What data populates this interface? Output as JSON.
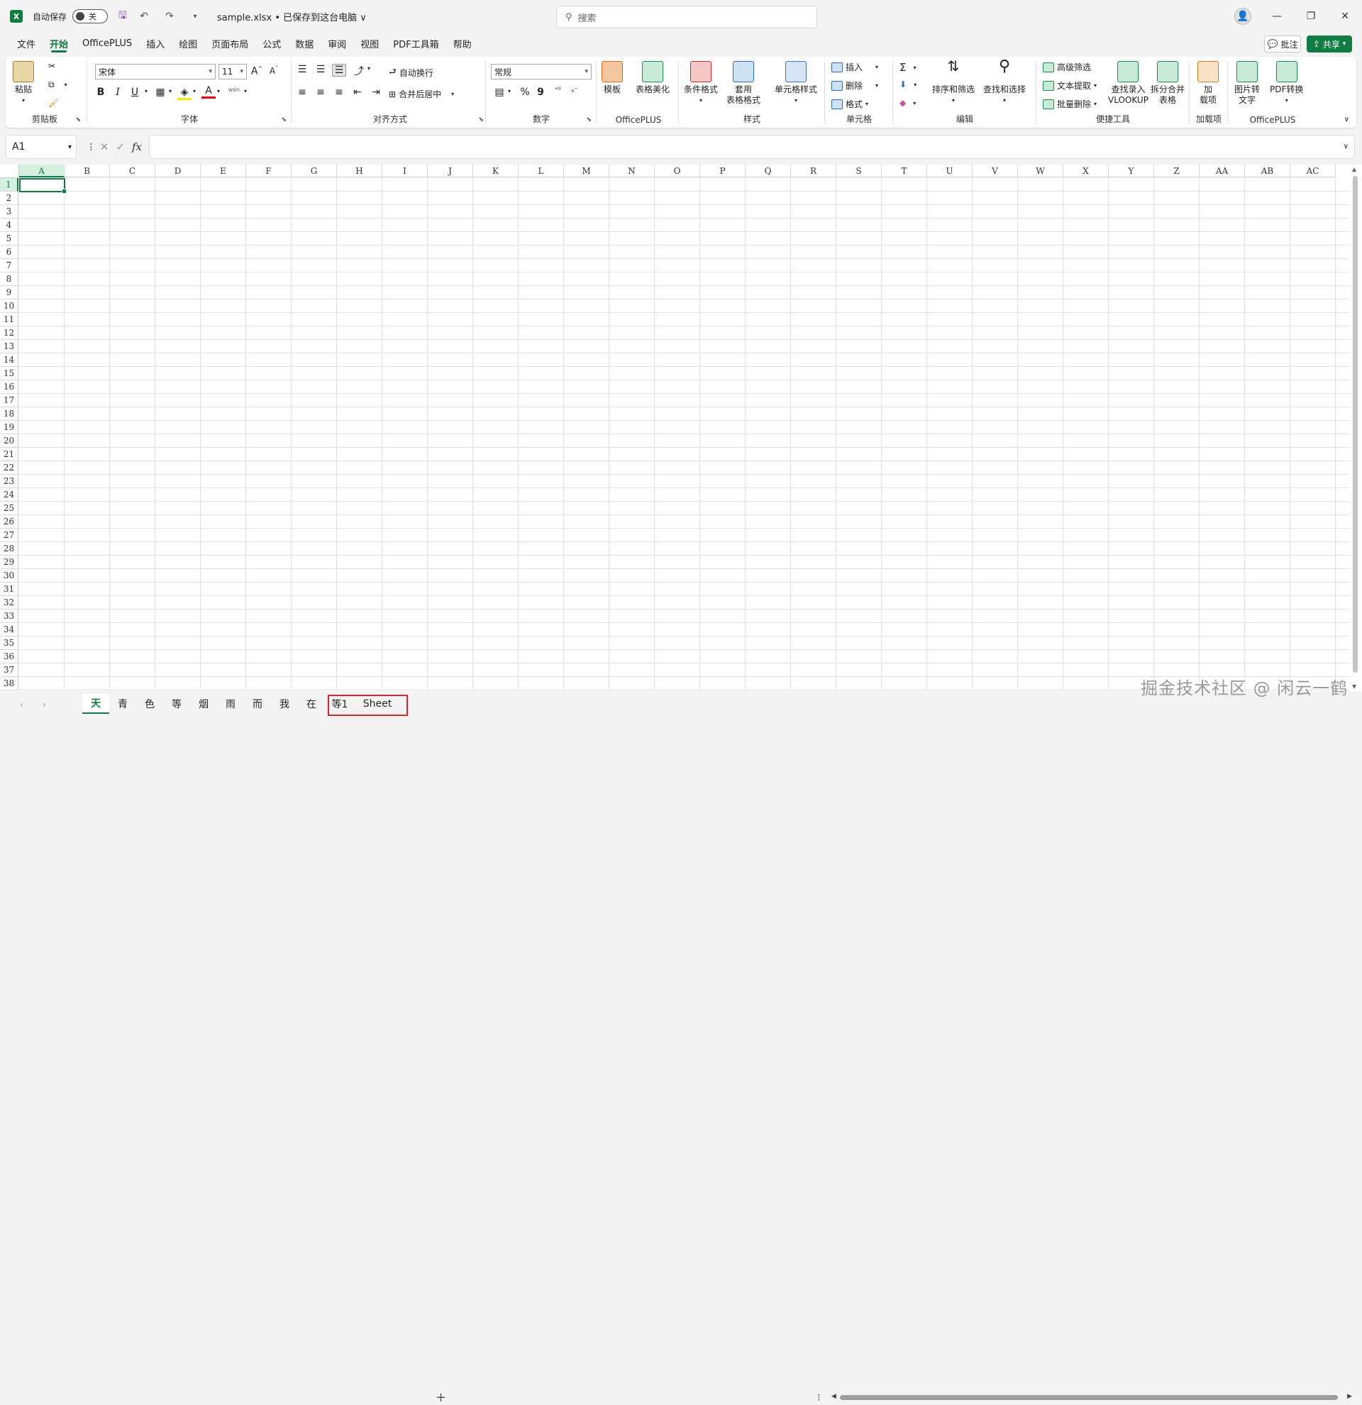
{
  "titlebar": {
    "autosave_label": "自动保存",
    "autosave_state": "关",
    "filename": "sample.xlsx • 已保存到这台电脑 ∨",
    "search_placeholder": "搜索",
    "excel_letter": "X"
  },
  "menu": {
    "tabs": [
      "文件",
      "开始",
      "OfficePLUS",
      "插入",
      "绘图",
      "页面布局",
      "公式",
      "数据",
      "审阅",
      "视图",
      "PDF工具箱",
      "帮助"
    ],
    "active_index": 1,
    "comment_label": "批注",
    "share_label": "共享"
  },
  "ribbon": {
    "clipboard": {
      "paste": "粘贴",
      "label": "剪贴板"
    },
    "font": {
      "family": "宋体",
      "size": "11",
      "label": "字体",
      "grow": "A",
      "shrink": "A",
      "bold": "B",
      "italic": "I",
      "underline": "U",
      "font_color": "A",
      "phonetic": "wén"
    },
    "align": {
      "wrap": "自动换行",
      "merge": "合并后居中",
      "label": "对齐方式"
    },
    "number": {
      "format": "常规",
      "percent": "%",
      "comma": "9",
      "label": "数字"
    },
    "officeplus1": {
      "template": "模板",
      "beautify": "表格美化",
      "label": "OfficePLUS"
    },
    "styles": {
      "conditional": "条件格式",
      "table_format_1": "套用",
      "table_format_2": "表格格式",
      "cell_style": "单元格样式",
      "label": "样式"
    },
    "cells": {
      "insert": "插入",
      "delete": "删除",
      "format": "格式",
      "label": "单元格"
    },
    "editing": {
      "sort": "排序和筛选",
      "find": "查找和选择",
      "sum": "Σ",
      "label": "编辑"
    },
    "quick": {
      "adv_filter": "高级筛选",
      "text_extract": "文本提取",
      "batch_delete": "批量删除",
      "lookup_1": "查找录入",
      "lookup_2": "VLOOKUP",
      "split_1": "拆分合并",
      "split_2": "表格",
      "label": "便捷工具"
    },
    "addins": {
      "addin_1": "加",
      "addin_2": "载项",
      "label": "加载项"
    },
    "officeplus2": {
      "img_1": "图片转",
      "img_2": "文字",
      "pdf": "PDF转换",
      "label": "OfficePLUS"
    }
  },
  "formula_bar": {
    "name_box": "A1",
    "fx": "fx",
    "value": ""
  },
  "grid": {
    "columns": [
      "A",
      "B",
      "C",
      "D",
      "E",
      "F",
      "G",
      "H",
      "I",
      "J",
      "K",
      "L",
      "M",
      "N",
      "O",
      "P",
      "Q",
      "R",
      "S",
      "T",
      "U",
      "V",
      "W",
      "X",
      "Y",
      "Z",
      "AA",
      "AB",
      "AC"
    ],
    "rows": [
      "1",
      "2",
      "3",
      "4",
      "5",
      "6",
      "7",
      "8",
      "9",
      "10",
      "11",
      "12",
      "13",
      "14",
      "15",
      "16",
      "17",
      "18",
      "19",
      "20",
      "21",
      "22",
      "23",
      "24",
      "25",
      "26",
      "27",
      "28",
      "29",
      "30",
      "31",
      "32",
      "33",
      "34",
      "35",
      "36",
      "37",
      "38"
    ],
    "active_cell": "A1"
  },
  "sheets": {
    "tabs": [
      "天",
      "青",
      "色",
      "等",
      "烟",
      "雨",
      "而",
      "我",
      "在",
      "等1",
      "Sheet"
    ],
    "active_index": 0,
    "add": "+"
  },
  "watermark": "掘金技术社区 @ 闲云一鹤",
  "colors": {
    "accent": "#107c41",
    "highlight": "#e0262d"
  }
}
